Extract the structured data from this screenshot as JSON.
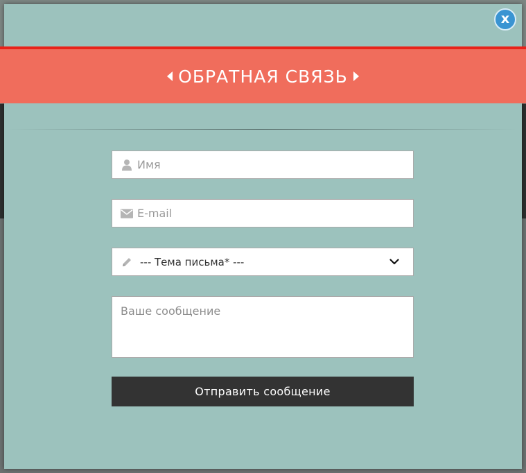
{
  "modal": {
    "close_label": "x",
    "title": "ОБРАТНАЯ СВЯЗЬ"
  },
  "form": {
    "name_placeholder": "Имя",
    "email_placeholder": "E-mail",
    "subject_selected": "--- Тема письма* ---",
    "message_placeholder": "Ваше сообщение",
    "submit_label": "Отправить сообщение"
  },
  "icons": {
    "name": "user-icon",
    "email": "envelope-icon",
    "subject": "pencil-icon",
    "select": "chevron-down-icon",
    "title_left": "caret-left-icon",
    "title_right": "caret-right-icon"
  },
  "colors": {
    "modal_bg": "#9cc2bd",
    "banner": "#f06d5c",
    "banner_accent": "#e8231a",
    "close_button": "#3a94d2",
    "submit_button": "#333333"
  }
}
